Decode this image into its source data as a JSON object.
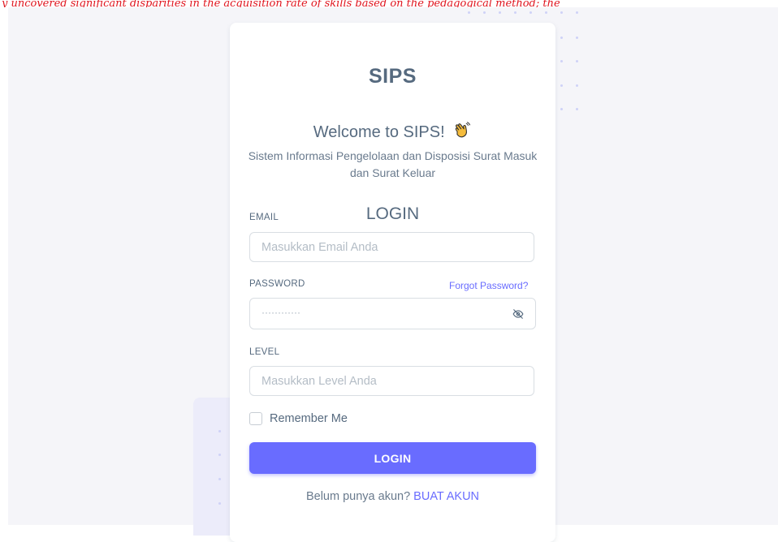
{
  "banner": {
    "text": "y uncovered significant disparities in the acquisition rate of skills based on the pedagogical method; the"
  },
  "card": {
    "brand": "SIPS",
    "welcome": "Welcome to SIPS!",
    "welcome_icon": "waving-hand-icon",
    "subtitle": "Sistem Informasi Pengelolaan dan Disposisi Surat Masuk dan Surat Keluar",
    "heading": "LOGIN"
  },
  "form": {
    "email": {
      "label": "EMAIL",
      "placeholder": "Masukkan Email Anda",
      "value": ""
    },
    "password": {
      "label": "PASSWORD",
      "masked_value": "············",
      "forgot_label": "Forgot Password?",
      "toggle_icon": "eye-off-icon"
    },
    "level": {
      "label": "LEVEL",
      "placeholder": "Masukkan Level Anda",
      "value": ""
    },
    "remember_label": "Remember Me",
    "remember_checked": false,
    "submit_label": "LOGIN"
  },
  "signup": {
    "prompt": "Belum punya akun?",
    "link_label": "BUAT AKUN"
  },
  "colors": {
    "primary": "#696cff",
    "heading": "#566a7f",
    "body_text": "#697a8d",
    "background": "#f5f5f9",
    "banner_text": "#e0141e"
  }
}
